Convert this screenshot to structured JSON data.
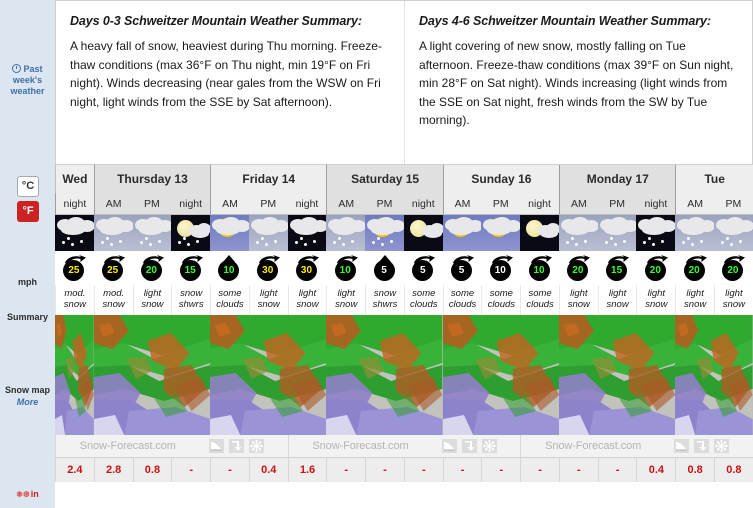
{
  "sidebar": {
    "past_week": "Past week's\nweather",
    "past_week_line1": "Past",
    "past_week_line2": "week's",
    "past_week_line3": "weather",
    "unit_c": "°C",
    "unit_f": "°F",
    "wind_unit": "mph",
    "summary_label": "Summary",
    "snow_map_label": "Snow map",
    "more_label": "More",
    "snow_unit": "in",
    "clock_icon": "clock-icon",
    "snowflake_icon": "snowflake-icon"
  },
  "summaries": [
    {
      "title": "Days 0-3 Schweitzer Mountain Weather Summary:",
      "body": "A heavy fall of snow, heaviest during Thu morning. Freeze-thaw conditions (max 36°F on Thu night, min 19°F on Fri night). Winds decreasing (near gales from the WSW on Fri night, light winds from the SSE by Sat afternoon)."
    },
    {
      "title": "Days 4-6 Schweitzer Mountain Weather Summary:",
      "body": "A light covering of new snow, mostly falling on Tue afternoon. Freeze-thaw conditions (max 39°F on Sun night, min 28°F on Sat night). Winds increasing (light winds from the SSE on Sat night, fresh winds from the SW by Tue morning)."
    }
  ],
  "days": [
    {
      "label": "Wed",
      "span": 1,
      "shade": "a"
    },
    {
      "label": "Thursday 13",
      "span": 3,
      "shade": "b"
    },
    {
      "label": "Friday 14",
      "span": 3,
      "shade": "a"
    },
    {
      "label": "Saturday 15",
      "span": 3,
      "shade": "b"
    },
    {
      "label": "Sunday 16",
      "span": 3,
      "shade": "a"
    },
    {
      "label": "Monday 17",
      "span": 3,
      "shade": "b"
    },
    {
      "label": "Tue",
      "span": 2,
      "shade": "a"
    }
  ],
  "columns": [
    {
      "time": "night",
      "day_start": true,
      "shade": "a",
      "icon": "cloud-snow-night",
      "wind": 25,
      "wind_color": "#ffee00",
      "wind_dir": "up-right",
      "summary": "mod.\nsnow",
      "summary_l1": "mod.",
      "summary_l2": "snow",
      "snow": "2.4"
    },
    {
      "time": "AM",
      "day_start": true,
      "shade": "b",
      "icon": "cloud-snow-dusk",
      "wind": 25,
      "wind_color": "#ffee00",
      "wind_dir": "up-right",
      "summary": "mod.\nsnow",
      "summary_l1": "mod.",
      "summary_l2": "snow",
      "snow": "2.8"
    },
    {
      "time": "PM",
      "day_start": false,
      "shade": "b",
      "icon": "cloud-snow-dusk",
      "wind": 20,
      "wind_color": "#33ff33",
      "wind_dir": "up-right",
      "summary": "light\nsnow",
      "summary_l1": "light",
      "summary_l2": "snow",
      "snow": "0.8"
    },
    {
      "time": "night",
      "day_start": false,
      "shade": "b",
      "icon": "moon-snow",
      "wind": 15,
      "wind_color": "#33ff33",
      "wind_dir": "up-right",
      "summary": "snow\nshwrs",
      "summary_l1": "snow",
      "summary_l2": "shwrs",
      "snow": "-"
    },
    {
      "time": "AM",
      "day_start": true,
      "shade": "a",
      "icon": "sun-cloud",
      "wind": 10,
      "wind_color": "#33ff33",
      "wind_dir": "up",
      "summary": "some\nclouds",
      "summary_l1": "some",
      "summary_l2": "clouds",
      "snow": "-"
    },
    {
      "time": "PM",
      "day_start": false,
      "shade": "a",
      "icon": "cloud-snow-dusk",
      "wind": 30,
      "wind_color": "#ffee00",
      "wind_dir": "up-right",
      "summary": "light\nsnow",
      "summary_l1": "light",
      "summary_l2": "snow",
      "snow": "0.4"
    },
    {
      "time": "night",
      "day_start": false,
      "shade": "a",
      "icon": "cloud-snow-night",
      "wind": 30,
      "wind_color": "#ffee00",
      "wind_dir": "up-right",
      "summary": "light\nsnow",
      "summary_l1": "light",
      "summary_l2": "snow",
      "snow": "1.6"
    },
    {
      "time": "AM",
      "day_start": true,
      "shade": "b",
      "icon": "cloud-snow-dusk",
      "wind": 10,
      "wind_color": "#33ff33",
      "wind_dir": "up-right",
      "summary": "light\nsnow",
      "summary_l1": "light",
      "summary_l2": "snow",
      "snow": "-"
    },
    {
      "time": "PM",
      "day_start": false,
      "shade": "b",
      "icon": "sun-cloud-snow",
      "wind": 5,
      "wind_color": "#ffffff",
      "wind_dir": "up",
      "summary": "snow\nshwrs",
      "summary_l1": "snow",
      "summary_l2": "shwrs",
      "snow": "-"
    },
    {
      "time": "night",
      "day_start": false,
      "shade": "b",
      "icon": "moon-cloud",
      "wind": 5,
      "wind_color": "#ffffff",
      "wind_dir": "up-right",
      "summary": "some\nclouds",
      "summary_l1": "some",
      "summary_l2": "clouds",
      "snow": "-"
    },
    {
      "time": "AM",
      "day_start": true,
      "shade": "a",
      "icon": "sun-cloud",
      "wind": 5,
      "wind_color": "#ffffff",
      "wind_dir": "up-right",
      "summary": "some\nclouds",
      "summary_l1": "some",
      "summary_l2": "clouds",
      "snow": "-"
    },
    {
      "time": "PM",
      "day_start": false,
      "shade": "a",
      "icon": "sun-cloud",
      "wind": 10,
      "wind_color": "#ffffff",
      "wind_dir": "up-right",
      "summary": "some\nclouds",
      "summary_l1": "some",
      "summary_l2": "clouds",
      "snow": "-"
    },
    {
      "time": "night",
      "day_start": false,
      "shade": "a",
      "icon": "moon-cloud",
      "wind": 10,
      "wind_color": "#33ff33",
      "wind_dir": "up-right",
      "summary": "some\nclouds",
      "summary_l1": "some",
      "summary_l2": "clouds",
      "snow": "-"
    },
    {
      "time": "AM",
      "day_start": true,
      "shade": "b",
      "icon": "cloud-snow-dusk",
      "wind": 20,
      "wind_color": "#33ff33",
      "wind_dir": "up-right",
      "summary": "light\nsnow",
      "summary_l1": "light",
      "summary_l2": "snow",
      "snow": "-"
    },
    {
      "time": "PM",
      "day_start": false,
      "shade": "b",
      "icon": "cloud-snow-dusk",
      "wind": 15,
      "wind_color": "#33ff33",
      "wind_dir": "up-right",
      "summary": "light\nsnow",
      "summary_l1": "light",
      "summary_l2": "snow",
      "snow": "-"
    },
    {
      "time": "night",
      "day_start": false,
      "shade": "b",
      "icon": "cloud-snow-night",
      "wind": 20,
      "wind_color": "#33ff33",
      "wind_dir": "up-right",
      "summary": "light\nsnow",
      "summary_l1": "light",
      "summary_l2": "snow",
      "snow": "0.4"
    },
    {
      "time": "AM",
      "day_start": true,
      "shade": "a",
      "icon": "cloud-snow-dusk",
      "wind": 20,
      "wind_color": "#33ff33",
      "wind_dir": "up-right",
      "summary": "light\nsnow",
      "summary_l1": "light",
      "summary_l2": "snow",
      "snow": "0.8"
    },
    {
      "time": "PM",
      "day_start": false,
      "shade": "a",
      "icon": "cloud-snow-dusk",
      "wind": 20,
      "wind_color": "#33ff33",
      "wind_dir": "up-right",
      "summary": "light\nsnow",
      "summary_l1": "light",
      "summary_l2": "snow",
      "snow": "0.8"
    }
  ],
  "map": {
    "watermark": "Snow-Forecast.com",
    "buttons": [
      {
        "icon": "curve-graph-icon",
        "name": "accumulation-curve-button"
      },
      {
        "icon": "download-arrow-icon",
        "name": "download-button"
      },
      {
        "icon": "expand-snowflake-icon",
        "name": "expand-button"
      }
    ]
  }
}
